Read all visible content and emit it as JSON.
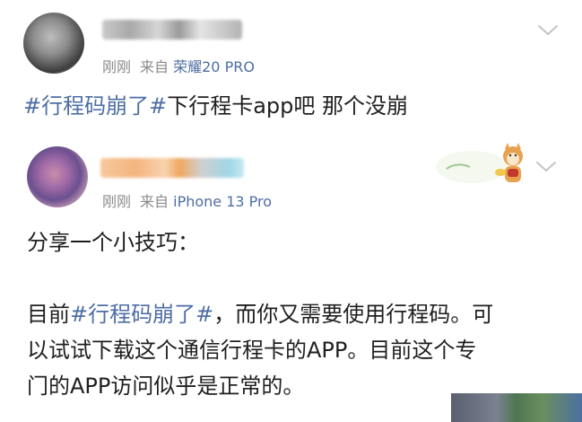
{
  "posts": [
    {
      "time": "刚刚",
      "from_label": "来自",
      "device": "荣耀20 PRO",
      "text_tag": "#行程码崩了#",
      "text_rest": "下行程卡app吧 那个没崩"
    },
    {
      "time": "刚刚",
      "from_label": "来自",
      "device": "iPhone 13 Pro",
      "line1": "分享一个小技巧：",
      "line2_prefix": "目前",
      "line2_tag": "#行程码崩了#",
      "line2_suffix": "，而你又需要使用行程码。可",
      "line3": "以试试下载这个通信行程卡的APP。目前这个专",
      "line4": "门的APP访问似乎是正常的。"
    }
  ],
  "colors": {
    "link": "#4e6ea3",
    "meta": "#8a8a8a",
    "text": "#1f1f1f"
  },
  "icons": [
    "chevron-down-icon",
    "shiba-sticker"
  ]
}
